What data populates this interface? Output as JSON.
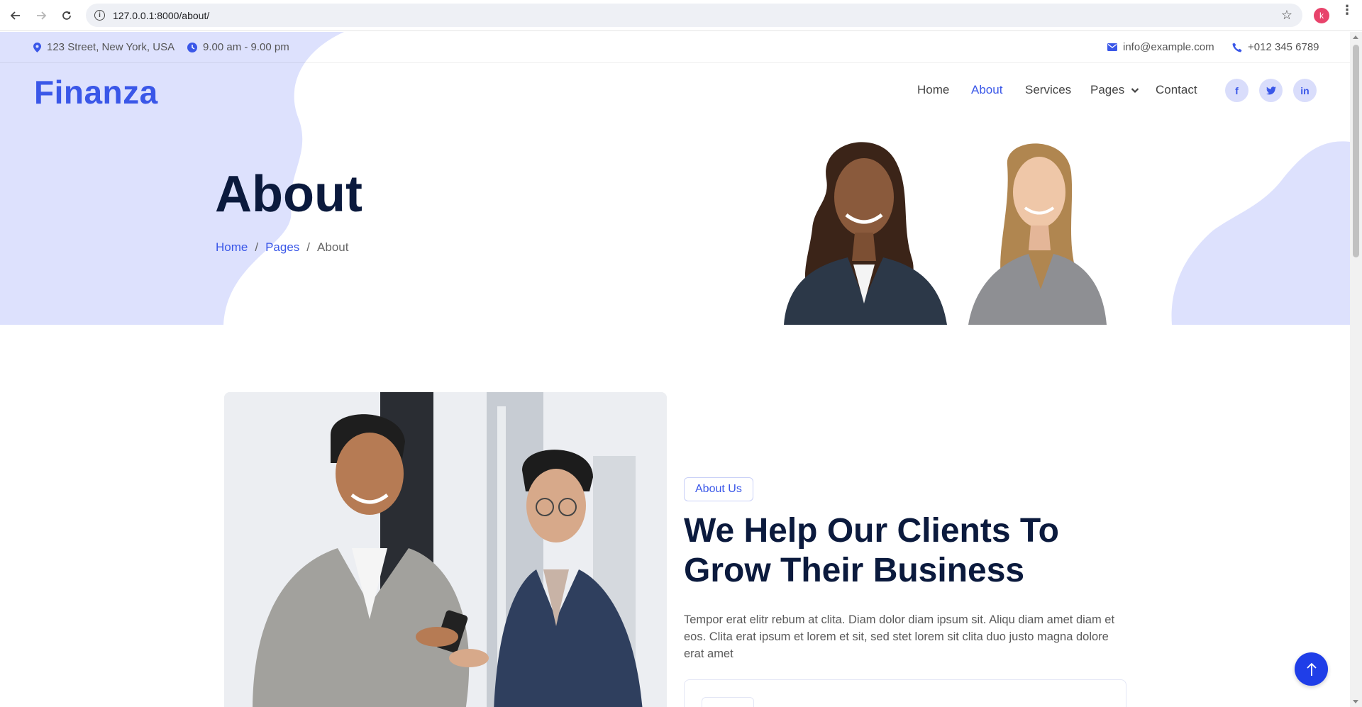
{
  "browser": {
    "url": "127.0.0.1:8000/about/",
    "profile_initial": "k"
  },
  "topbar": {
    "address": "123 Street, New York, USA",
    "hours": "9.00 am - 9.00 pm",
    "email": "info@example.com",
    "phone": "+012 345 6789"
  },
  "navbar": {
    "brand": "Finanza",
    "items": [
      {
        "label": "Home",
        "active": false
      },
      {
        "label": "About",
        "active": true
      },
      {
        "label": "Services",
        "active": false
      },
      {
        "label": "Pages",
        "active": false,
        "dropdown": true
      },
      {
        "label": "Contact",
        "active": false
      }
    ],
    "social": [
      {
        "icon": "facebook-icon",
        "glyph": "f"
      },
      {
        "icon": "twitter-icon",
        "glyph": "t"
      },
      {
        "icon": "linkedin-icon",
        "glyph": "in"
      }
    ]
  },
  "hero": {
    "title": "About",
    "breadcrumb": [
      {
        "label": "Home",
        "link": true
      },
      {
        "label": "Pages",
        "link": true
      },
      {
        "label": "About",
        "link": false
      }
    ]
  },
  "about": {
    "badge": "About Us",
    "heading": "We Help Our Clients To Grow Their Business",
    "text": "Tempor erat elitr rebum at clita. Diam dolor diam ipsum sit. Aliqu diam amet diam et eos. Clita erat ipsum et lorem et sit, sed stet lorem sit clita duo justo magna dolore erat amet"
  },
  "colors": {
    "accent": "#3a57e8",
    "hero_blob": "#dde1fd",
    "heading": "#0b1a3d"
  }
}
